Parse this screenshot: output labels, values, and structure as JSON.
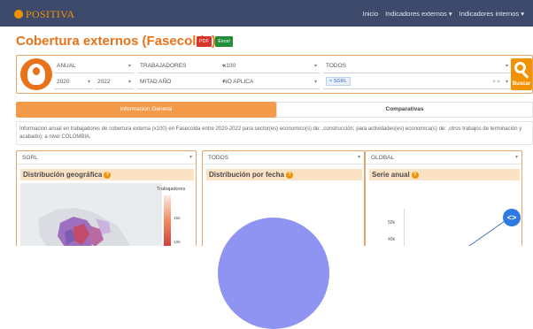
{
  "brand": {
    "name": "POSITIVA",
    "color": "#f39200"
  },
  "nav": {
    "inicio": "Inicio",
    "externos": "Indicadores externos ▾",
    "internos": "Indicadores internos ▾"
  },
  "page": {
    "title": "Cobertura externos (Fasecolda)",
    "pdf_label": "PDF",
    "excel_label": "Excel"
  },
  "filters": {
    "periodicidad": "ANUAL",
    "variable": "TRABAJADORES",
    "escala": "x100",
    "actividad": "TODOS",
    "anio_inicio": "2020",
    "anio_fin": "2022",
    "corte": "MITAD AÑO",
    "aplica": "NO APLICA",
    "sector_tag": "× SGRL",
    "search_label": "Buscar"
  },
  "tabs": {
    "general": "Informacion General",
    "comparativas": "Comparativas"
  },
  "description": "Informacion anual en trabajadores de cobertura externa (x100) en Fasecolda entre 2020-2022 para sector(es) economico(s) de: ,construcción; para actividades(es) economica(s) de: ,otros trabajos de terminación y acabado); a nivel COLOMBIA.",
  "panels": {
    "geo": {
      "select": "SGRL",
      "title": "Distribución geográfica",
      "legend_title": "Trabajadores",
      "legend_ticks": [
        "15k",
        "10k"
      ]
    },
    "fecha": {
      "select": "TODOS",
      "title": "Distribución por fecha"
    },
    "anual": {
      "select": "GLOBAL",
      "title": "Serie anual",
      "yticks": [
        "50k",
        "40k"
      ]
    }
  },
  "icons": {
    "info": "info-icon",
    "search": "search-icon",
    "fab": "code-icon"
  }
}
